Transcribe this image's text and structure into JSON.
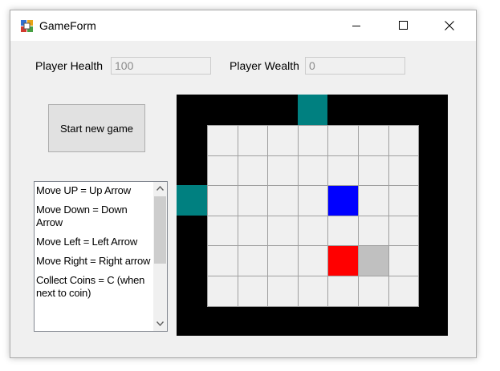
{
  "window": {
    "title": "GameForm"
  },
  "titlebar_buttons": {
    "minimize": "minimize-icon",
    "maximize": "maximize-icon",
    "close": "close-icon"
  },
  "stats": {
    "health_label": "Player Health",
    "health_value": "100",
    "wealth_label": "Player Wealth",
    "wealth_value": "0"
  },
  "start_button": {
    "label": "Start new game"
  },
  "instructions": [
    "Move UP = Up Arrow",
    "Move Down = Down Arrow",
    "Move Left = Left Arrow",
    "Move Right = Right arrow",
    "Collect Coins = C (when next to coin)"
  ],
  "board": {
    "rows": 6,
    "cols": 7,
    "colors": {
      "wall": "#000000",
      "floor": "#f0f0f0",
      "grid_line": "#a0a0a0",
      "door": "#008080",
      "player": "#0000ff",
      "enemy": "#ff0000",
      "coin": "#c0c0c0"
    },
    "player": {
      "row": 2,
      "col": 4
    },
    "enemy": {
      "row": 4,
      "col": 4
    },
    "coin": {
      "row": 4,
      "col": 5
    },
    "doors": [
      {
        "side": "top",
        "index": 3
      },
      {
        "side": "left",
        "index": 2
      }
    ]
  }
}
